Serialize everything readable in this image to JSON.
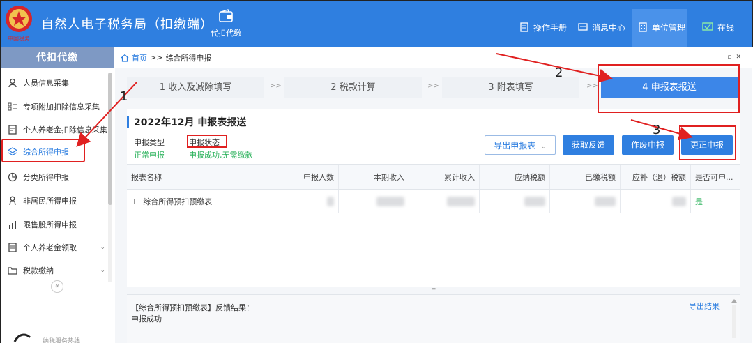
{
  "header": {
    "app_title": "自然人电子税务局（扣缴端）",
    "nav_main": "代扣代缴",
    "nav_manual": "操作手册",
    "nav_messages": "消息中心",
    "nav_unit": "单位管理",
    "nav_online": "在线",
    "emblem_text": "中国税务"
  },
  "sidebar": {
    "title": "代扣代缴",
    "items": [
      {
        "label": "人员信息采集",
        "icon": "user-icon"
      },
      {
        "label": "专项附加扣除信息采集",
        "icon": "list-icon"
      },
      {
        "label": "个人养老金扣除信息采集",
        "icon": "badge-icon"
      },
      {
        "label": "综合所得申报",
        "icon": "layers-icon"
      },
      {
        "label": "分类所得申报",
        "icon": "pie-icon"
      },
      {
        "label": "非居民所得申报",
        "icon": "person-icon"
      },
      {
        "label": "限售股所得申报",
        "icon": "bar-chart-icon"
      },
      {
        "label": "个人养老金领取",
        "icon": "document-icon"
      },
      {
        "label": "税款缴纳",
        "icon": "folder-icon"
      }
    ],
    "collapse": "«",
    "footer_text": "纳税服务热线"
  },
  "breadcrumb": {
    "home": "首页",
    "sep": ">>",
    "current": "综合所得申报"
  },
  "steps": [
    {
      "label": "1 收入及减除填写"
    },
    {
      "label": "2 税款计算"
    },
    {
      "label": "3 附表填写"
    },
    {
      "label": "4 申报表报送"
    }
  ],
  "step_sep": ">>",
  "panel": {
    "title": "2022年12月  申报表报送",
    "type_label": "申报类型",
    "type_value": "正常申报",
    "status_label": "申报状态",
    "status_value": "申报成功,无需缴款",
    "buttons": {
      "export": "导出申报表",
      "feedback": "获取反馈",
      "void": "作废申报",
      "correct": "更正申报"
    }
  },
  "table": {
    "columns": [
      "报表名称",
      "申报人数",
      "本期收入",
      "累计收入",
      "应纳税额",
      "已缴税额",
      "应补（退）税额",
      "是否可申..."
    ],
    "rows": [
      {
        "name": "综合所得预扣预缴表",
        "expand": "+",
        "can_declare": "是"
      }
    ]
  },
  "feedback": {
    "head": "【综合所得预扣预缴表】反馈结果：",
    "body": "申报成功",
    "export_link": "导出结果"
  },
  "annotations": {
    "n1": "1",
    "n2": "2",
    "n3": "3",
    "color": "#e02020"
  },
  "colors": {
    "brand": "#2f7fe0",
    "sidebar_head": "#7e99c4",
    "success": "#2eb35e"
  }
}
